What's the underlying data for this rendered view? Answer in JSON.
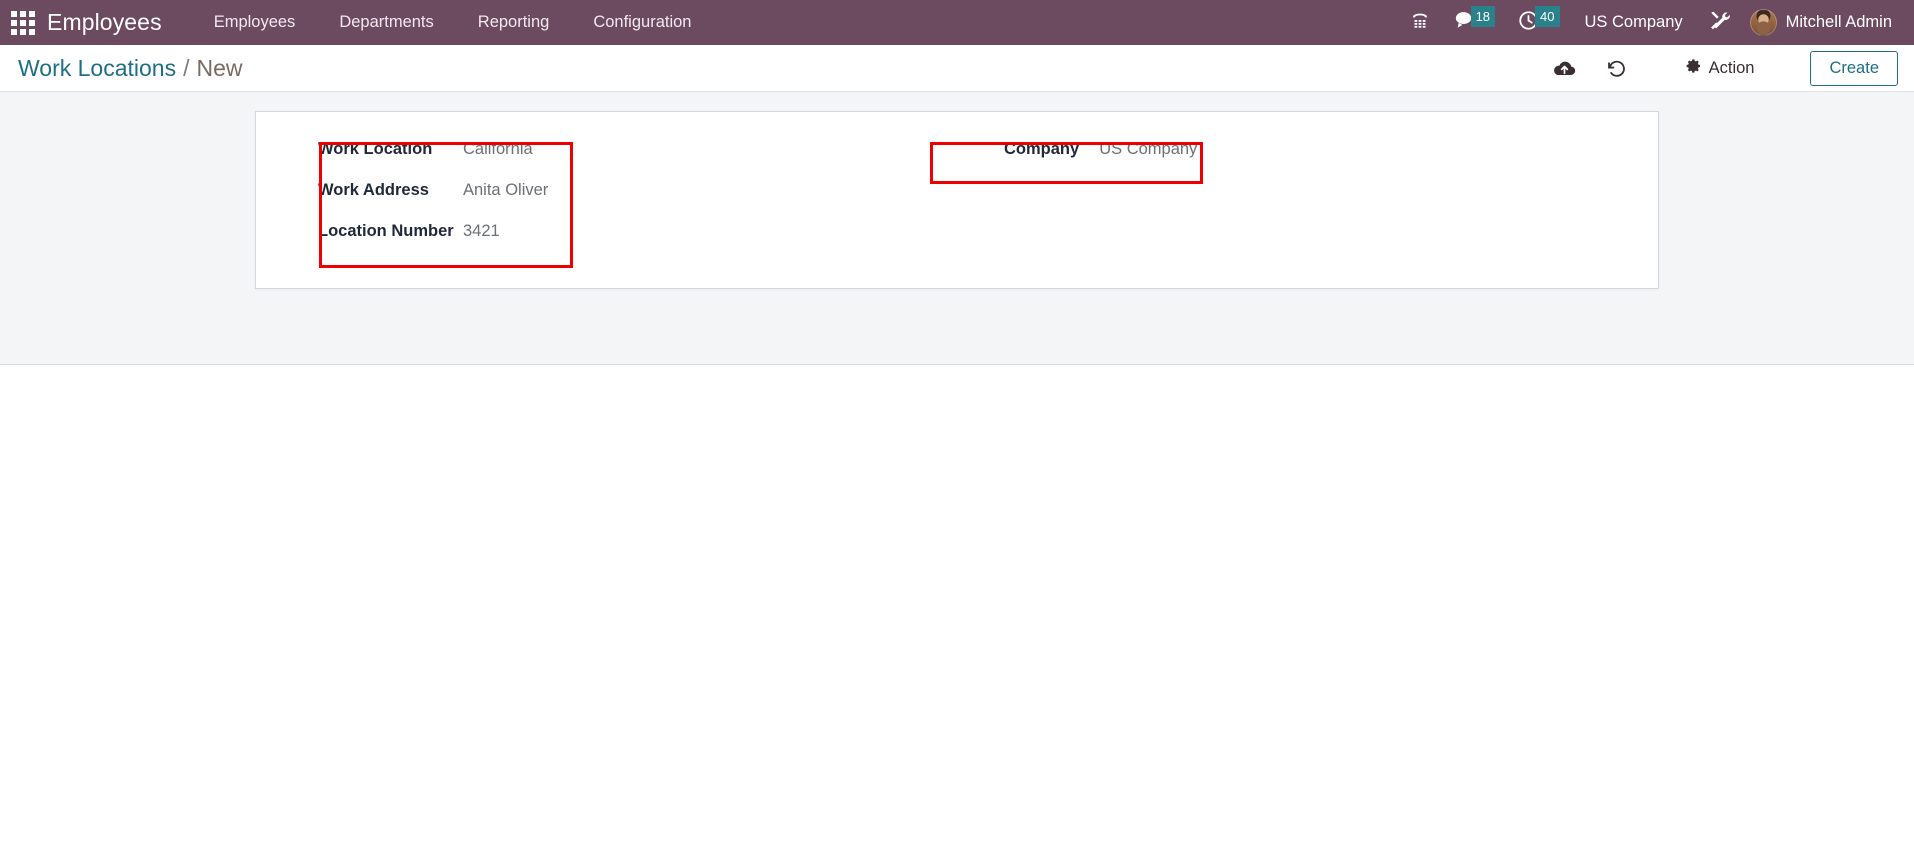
{
  "navbar": {
    "apps_icon": "apps-grid-icon",
    "brand": "Employees",
    "menu_items": [
      {
        "label": "Employees"
      },
      {
        "label": "Departments"
      },
      {
        "label": "Reporting"
      },
      {
        "label": "Configuration"
      }
    ],
    "voip_icon": "telephone-icon",
    "messages_icon": "chat-bubble-icon",
    "messages_count": "18",
    "activities_icon": "clock-icon",
    "activities_count": "40",
    "company": "US Company",
    "debug_icon": "tools-icon",
    "avatar_icon": "user-avatar",
    "user_name": "Mitchell Admin",
    "colors": {
      "navbar_bg": "#6C4A60",
      "badge_bg": "#28818B"
    }
  },
  "control_panel": {
    "breadcrumb": {
      "root": "Work Locations",
      "separator": "/",
      "current": "New"
    },
    "save_icon": "cloud-upload-icon",
    "discard_icon": "undo-icon",
    "action_gear_icon": "gear-icon",
    "action_label": "Action",
    "create_label": "Create",
    "colors": {
      "accent": "#1F6F84"
    }
  },
  "form": {
    "left_fields": [
      {
        "label": "Work Location",
        "value": "California"
      },
      {
        "label": "Work Address",
        "value": "Anita Oliver"
      },
      {
        "label": "Location Number",
        "value": "3421"
      }
    ],
    "right_fields": [
      {
        "label": "Company",
        "value": "US Company"
      }
    ]
  },
  "annotations": {
    "highlight_color": "#ef0000",
    "boxes": [
      {
        "name": "left-fields-highlight"
      },
      {
        "name": "company-field-highlight"
      }
    ]
  }
}
